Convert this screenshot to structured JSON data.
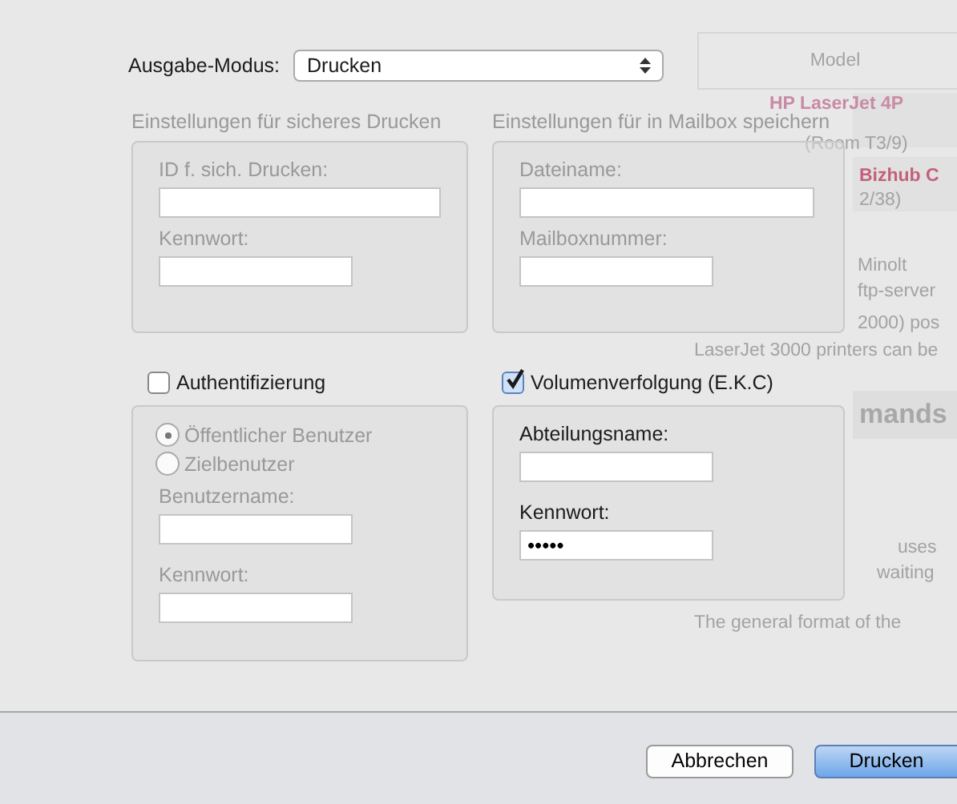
{
  "background_page": {
    "table_header": "Model",
    "rows": [
      {
        "name": "HP LaserJet 4P",
        "room": "(Room T3/9)",
        "color": "#c98aa5"
      },
      {
        "name": "Bizhub C",
        "room": "2/38)",
        "color": "#c4607a"
      }
    ],
    "paragraphs": [
      "Minolt",
      "ftp-server",
      "2000) pos",
      "LaserJet 3000 printers can be"
    ],
    "heading": "mands",
    "body": [
      "uses",
      "waiting",
      "The general format of the"
    ]
  },
  "output_mode": {
    "label": "Ausgabe-Modus:",
    "value": "Drucken"
  },
  "top_groups": [
    {
      "title": "Einstellungen für sicheres Drucken",
      "disabled": true,
      "fields": [
        {
          "label": "ID f. sich. Drucken:"
        },
        {
          "label": "Kennwort:"
        }
      ]
    },
    {
      "title": "Einstellungen für in Mailbox speichern",
      "disabled": true,
      "fields": [
        {
          "label": "Dateiname:"
        },
        {
          "label": "Mailboxnummer:"
        }
      ]
    }
  ],
  "bottom_groups": [
    {
      "label": "Authentifizierung",
      "checked": false,
      "disabled": true,
      "radios": [
        {
          "label": "Öffentlicher Benutzer",
          "selected": true
        },
        {
          "label": "Zielbenutzer",
          "selected": false
        }
      ],
      "fields": [
        {
          "label": "Benutzername:"
        },
        {
          "label": "Kennwort:"
        }
      ]
    },
    {
      "label": "Volumenverfolgung (E.K.C)",
      "checked": true,
      "disabled": false,
      "fields": [
        {
          "label": "Abteilungsname:"
        },
        {
          "label": "Kennwort:",
          "value": "•••••"
        }
      ]
    }
  ],
  "buttons": [
    {
      "label": "Abbrechen",
      "default": false
    },
    {
      "label": "Drucken",
      "default": true
    }
  ]
}
